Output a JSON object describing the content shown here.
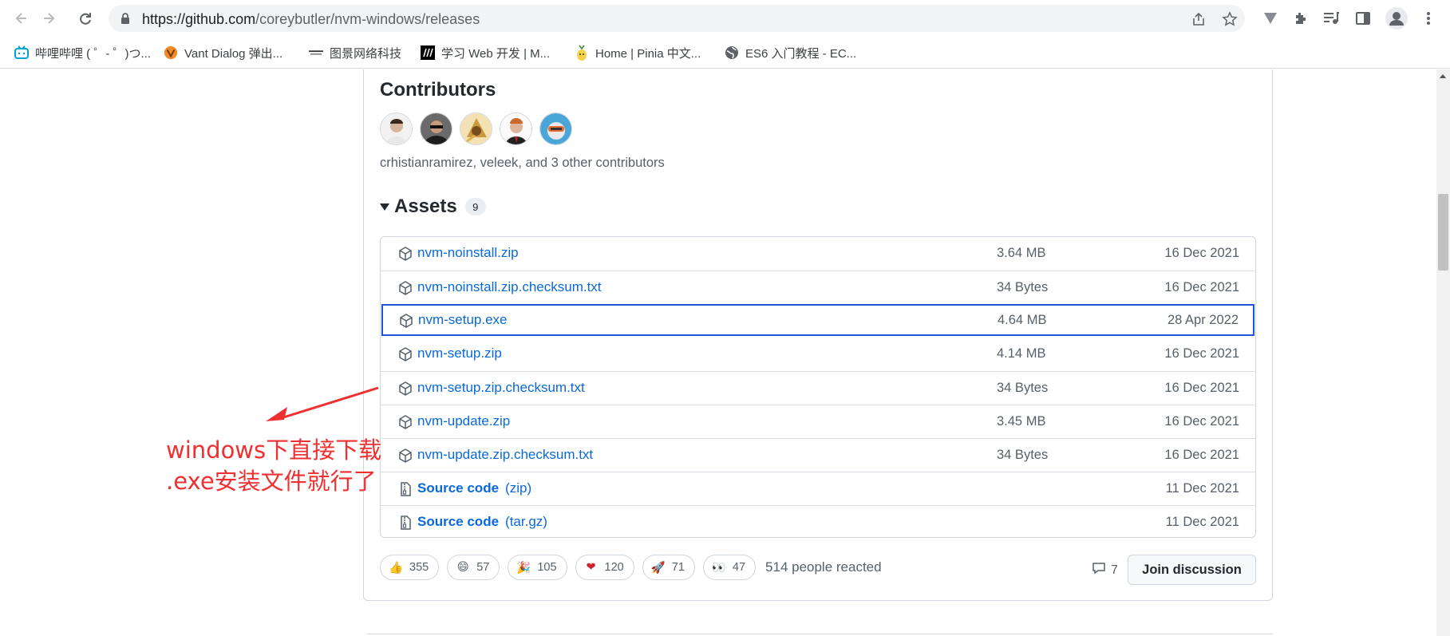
{
  "browser": {
    "url_host": "https://github.com",
    "url_path": "/coreybutler/nvm-windows/releases",
    "bookmarks": [
      {
        "label": "哔哩哔哩 ( ゜- ゜)つ...",
        "icon": "bilibili-icon"
      },
      {
        "label": "Vant Dialog 弹出...",
        "icon": "vant-icon"
      },
      {
        "label": "图景网络科技",
        "icon": "tujing-icon"
      },
      {
        "label": "学习 Web 开发 | M...",
        "icon": "mdn-icon"
      },
      {
        "label": "Home | Pinia 中文...",
        "icon": "pinia-icon"
      },
      {
        "label": "ES6 入门教程 - EC...",
        "icon": "globe-icon"
      }
    ]
  },
  "contributors": {
    "title": "Contributors",
    "text": "crhistianramirez, veleek, and 3 other contributors"
  },
  "assets": {
    "label": "Assets",
    "count": "9",
    "items": [
      {
        "name": "nvm-noinstall.zip",
        "ext": "",
        "size": "3.64 MB",
        "date": "16 Dec 2021",
        "icon": "package-icon"
      },
      {
        "name": "nvm-noinstall.zip.checksum.txt",
        "ext": "",
        "size": "34 Bytes",
        "date": "16 Dec 2021",
        "icon": "package-icon"
      },
      {
        "name": "nvm-setup.exe",
        "ext": "",
        "size": "4.64 MB",
        "date": "28 Apr 2022",
        "icon": "package-icon",
        "highlighted": true
      },
      {
        "name": "nvm-setup.zip",
        "ext": "",
        "size": "4.14 MB",
        "date": "16 Dec 2021",
        "icon": "package-icon"
      },
      {
        "name": "nvm-setup.zip.checksum.txt",
        "ext": "",
        "size": "34 Bytes",
        "date": "16 Dec 2021",
        "icon": "package-icon"
      },
      {
        "name": "nvm-update.zip",
        "ext": "",
        "size": "3.45 MB",
        "date": "16 Dec 2021",
        "icon": "package-icon"
      },
      {
        "name": "nvm-update.zip.checksum.txt",
        "ext": "",
        "size": "34 Bytes",
        "date": "16 Dec 2021",
        "icon": "package-icon"
      },
      {
        "name": "Source code",
        "ext": "(zip)",
        "size": "",
        "date": "11 Dec 2021",
        "icon": "file-zip-icon"
      },
      {
        "name": "Source code",
        "ext": "(tar.gz)",
        "size": "",
        "date": "11 Dec 2021",
        "icon": "file-zip-icon"
      }
    ]
  },
  "reactions": {
    "items": [
      {
        "emoji": "👍",
        "icon": "thumbs-up-icon",
        "count": "355"
      },
      {
        "emoji": "😄",
        "icon": "smile-icon",
        "count": "57"
      },
      {
        "emoji": "🎉",
        "icon": "tada-icon",
        "count": "105"
      },
      {
        "emoji": "❤",
        "icon": "heart-icon",
        "count": "120"
      },
      {
        "emoji": "🚀",
        "icon": "rocket-icon",
        "count": "71"
      },
      {
        "emoji": "👀",
        "icon": "eyes-icon",
        "count": "47"
      }
    ],
    "summary": "514 people reacted"
  },
  "discussion": {
    "comment_count": "7",
    "join_label": "Join discussion"
  },
  "annotation": {
    "line1": "windows下直接下载",
    "line2": ".exe安装文件就行了",
    "color": "#f03030"
  },
  "colors": {
    "link": "#0969da",
    "highlight_border": "#1f55d6"
  }
}
